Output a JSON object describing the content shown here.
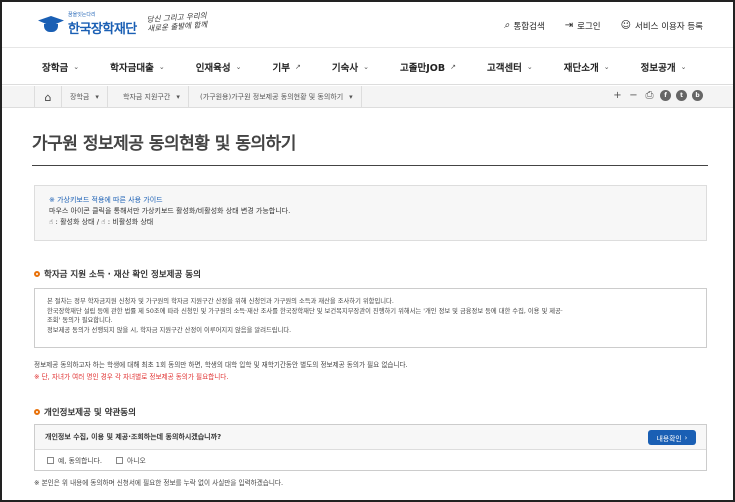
{
  "header": {
    "logo_sub": "꿈을잇는다리",
    "logo_main": "한국장학재단",
    "slogan_line1": "당신 그리고 우리의",
    "slogan_line2": "새로운 출발에 함께",
    "util": [
      {
        "icon": "search-icon",
        "glyph": "⌕",
        "label": "통합검색"
      },
      {
        "icon": "login-icon",
        "glyph": "⇥",
        "label": "로그인"
      },
      {
        "icon": "user-add-icon",
        "glyph": "☺",
        "label": "서비스 이용자 등록"
      }
    ]
  },
  "gnb": [
    {
      "label": "장학금",
      "suffix": "⌄"
    },
    {
      "label": "학자금대출",
      "suffix": "⌄"
    },
    {
      "label": "인재육성",
      "suffix": "⌄"
    },
    {
      "label": "기부",
      "suffix": "↗"
    },
    {
      "label": "기숙사",
      "suffix": "⌄"
    },
    {
      "label": "고졸만JOB",
      "suffix": "↗"
    },
    {
      "label": "고객센터",
      "suffix": "⌄"
    },
    {
      "label": "재단소개",
      "suffix": "⌄"
    },
    {
      "label": "정보공개",
      "suffix": "⌄"
    }
  ],
  "breadcrumb": {
    "home_glyph": "⌂",
    "items": [
      "장학금",
      "학자금 지원구간",
      "(가구원용)가구원 정보제공 동의현황 및 동의하기"
    ],
    "arrow": "▾"
  },
  "tools": {
    "plus": "+",
    "minus": "−",
    "print": "⎙",
    "fb": "f",
    "tw": "t",
    "blog": "b"
  },
  "page": {
    "title": "가구원 정보제공 동의현황 및 동의하기",
    "guide_title": "※ 가상키보드 적용에 따른 사용 가이드",
    "guide_line1": "마우스 아이콘 클릭을 통해서만 가상키보드 활성화/비활성화 상태 변경 가능합니다.",
    "guide_line2": "☝ : 활성화 상태 / ☝ : 비활성화 상태",
    "section1_title": "학자금 지원 소득 · 재산 확인 정보제공 동의",
    "info_line1": "본 절차는 정부 학자금지원 신청자 및 가구원의 학자금 지원구간 산정을 위해 신청인과 가구원의 소득과 재산을 조사하기 위함입니다.",
    "info_line2": "한국장학재단 설립 등에 관한 법률 제 50조에 따라 신청인 및 가구원의 소득·재산 조사를 한국장학재단 및 보건복지부장관이 진행하기 위해서는 '개인 정보 및 금융정보 등에 대한 수집, 이용 및 제공·",
    "info_line3": "조회' 동의가 필요합니다.",
    "info_line4": "정보제공 동의가 선행되지 않을 시, 학자금 지원구간 산정이 이루어지지 않음을 알려드립니다.",
    "note1": "정보제공 동의하고자 하는 학생에 대해 최초 1회 동의만 하면, 학생의 대학 입학 및 재학기간동안 별도의 정보제공 동의가 필요 없습니다.",
    "note2": "※ 단, 자녀가 여러 명인 경우 각 자녀별로 정보제공 동의가 필요합니다.",
    "section2_title": "개인정보제공 및 약관동의",
    "agree_question": "개인정보 수집, 이용 및 제공·조회하는데 동의하시겠습니까?",
    "detail_button": "내용확인",
    "detail_glyph": "›",
    "opt_yes": "예, 동의합니다.",
    "opt_no": "아니오",
    "footer_note": "※ 본인은 위 내용에 동의하며 신청서에 필요한 정보를 누락 없이 사실만을 입력하겠습니다."
  }
}
